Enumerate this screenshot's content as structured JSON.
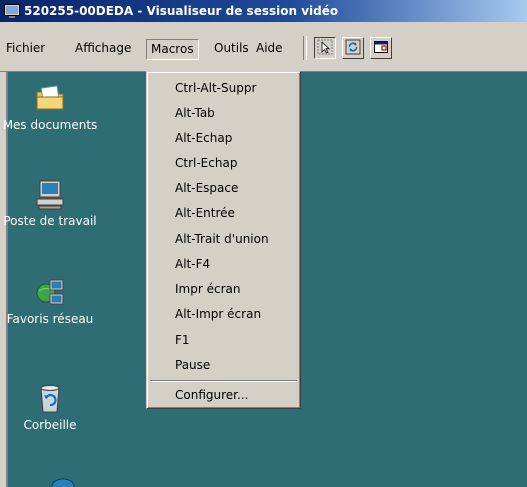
{
  "window": {
    "title": "520255-00DEDA - Visualiseur de session vidéo",
    "icon": "monitor-icon"
  },
  "menubar": {
    "items": [
      "Fichier",
      "Affichage",
      "Macros",
      "Outils",
      "Aide"
    ],
    "open_menu": "Macros",
    "tools": [
      "cursor-select-icon",
      "refresh-icon",
      "window-maximize-icon"
    ]
  },
  "macros_menu": {
    "items": [
      "Ctrl-Alt-Suppr",
      "Alt-Tab",
      "Alt-Echap",
      "Ctrl-Echap",
      "Alt-Espace",
      "Alt-Entrée",
      "Alt-Trait d'union",
      "Alt-F4",
      "Impr écran",
      "Alt-Impr écran",
      "F1",
      "Pause"
    ],
    "configure": "Configurer..."
  },
  "desktop": {
    "background": "#2f6d74",
    "icons": [
      {
        "label": "Mes documents",
        "icon": "folder-documents-icon"
      },
      {
        "label": "Poste de travail",
        "icon": "computer-icon"
      },
      {
        "label": "Favoris réseau",
        "icon": "network-icon"
      },
      {
        "label": "Corbeille",
        "icon": "recycle-bin-icon"
      }
    ]
  }
}
